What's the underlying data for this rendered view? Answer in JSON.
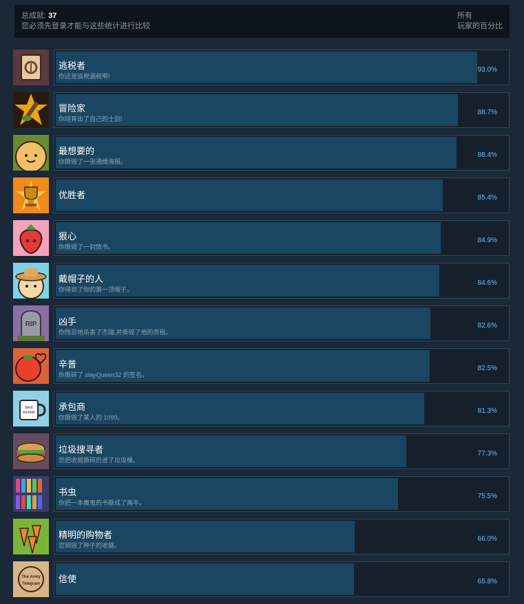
{
  "summary": {
    "total_label": "总成就:",
    "total_count": "37",
    "login_note": "您必须先登录才能与这些统计进行比较",
    "column_line1": "所有",
    "column_line2": "玩家的百分比"
  },
  "achievements": [
    {
      "name": "逃税者",
      "desc": "你这是偷税漏税啊!",
      "percent_label": "93.0%",
      "percent": 93.0,
      "icon": "tax-form-icon",
      "color": "#5a3a3e"
    },
    {
      "name": "冒险家",
      "desc": "你培育出了自己的土剑!",
      "percent_label": "88.7%",
      "percent": 88.7,
      "icon": "dirt-sword-icon",
      "color": "#e9a21b"
    },
    {
      "name": "最想要的",
      "desc": "你撕毁了一张通缉海报。",
      "percent_label": "88.4%",
      "percent": 88.4,
      "icon": "onion-face-icon",
      "color": "#6b8a2e"
    },
    {
      "name": "优胜者",
      "desc": "",
      "percent_label": "85.4%",
      "percent": 85.4,
      "icon": "trophy-icon",
      "color": "#f08a1c"
    },
    {
      "name": "狠心",
      "desc": "你撕毁了一封情书。",
      "percent_label": "84.9%",
      "percent": 84.9,
      "icon": "strawberry-icon",
      "color": "#f5a3b8"
    },
    {
      "name": "戴帽子的人",
      "desc": "你得到了你的第一顶帽子。",
      "percent_label": "84.6%",
      "percent": 84.6,
      "icon": "hat-face-icon",
      "color": "#7fd3e8"
    },
    {
      "name": "凶手",
      "desc": "你残忍地杀害了杰瑞,并撕毁了他的房租。",
      "percent_label": "82.6%",
      "percent": 82.6,
      "icon": "tombstone-icon",
      "color": "#8a6fa3"
    },
    {
      "name": "辛普",
      "desc": "你撕碎了 slayQueen32 的签名。",
      "percent_label": "82.5%",
      "percent": 82.5,
      "icon": "tomato-heart-icon",
      "color": "#d9623a"
    },
    {
      "name": "承包商",
      "desc": "你撕毁了某人的 1099。",
      "percent_label": "81.3%",
      "percent": 81.3,
      "icon": "mug-icon",
      "color": "#8fd0e6"
    },
    {
      "name": "垃圾搜寻者",
      "desc": "您把收据撕碎扔进了垃圾桶。",
      "percent_label": "77.3%",
      "percent": 77.3,
      "icon": "sandwich-icon",
      "color": "#6a4a5e"
    },
    {
      "name": "书虫",
      "desc": "你把一本魔鬼的书撕成了两半。",
      "percent_label": "75.5%",
      "percent": 75.5,
      "icon": "bookshelf-icon",
      "color": "#3c3a6e"
    },
    {
      "name": "精明的购物者",
      "desc": "您销毁了种子的收据。",
      "percent_label": "66.0%",
      "percent": 66.0,
      "icon": "carrots-icon",
      "color": "#7ab53a"
    },
    {
      "name": "信使",
      "desc": "",
      "percent_label": "65.8%",
      "percent": 65.8,
      "icon": "army-telegram-icon",
      "color": "#d9b48a"
    }
  ],
  "icon_text": {
    "rip": "RIP",
    "mug_line1": "best",
    "mug_line2": "worker",
    "army_line1": "The Army",
    "army_line2": "Telegram"
  }
}
